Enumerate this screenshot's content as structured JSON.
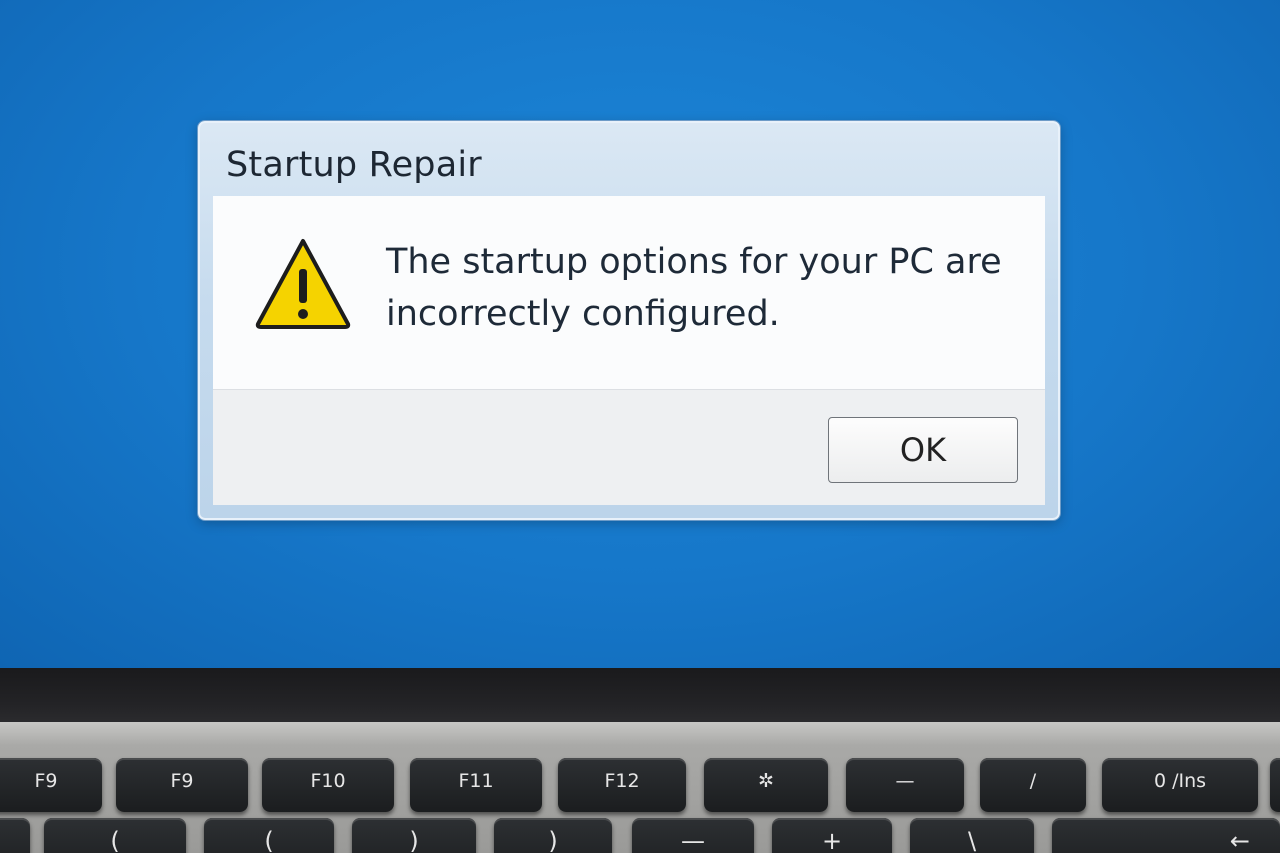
{
  "dialog": {
    "title": "Startup Repair",
    "icon": "warning-icon",
    "message": "The startup options for your PC are incorrectly configured.",
    "ok_label": "OK"
  },
  "colors": {
    "desktop": "#1677c9",
    "warning_fill": "#f5d300",
    "warning_stroke": "#1d1d1d"
  },
  "keyboard": {
    "row1": [
      "F9",
      "F9",
      "F10",
      "F11",
      "F12",
      "✲",
      "—",
      "/",
      "0 /Ins"
    ],
    "row2": [
      "(",
      "(",
      ")",
      ")",
      "—",
      "+",
      "\\",
      "←"
    ]
  }
}
